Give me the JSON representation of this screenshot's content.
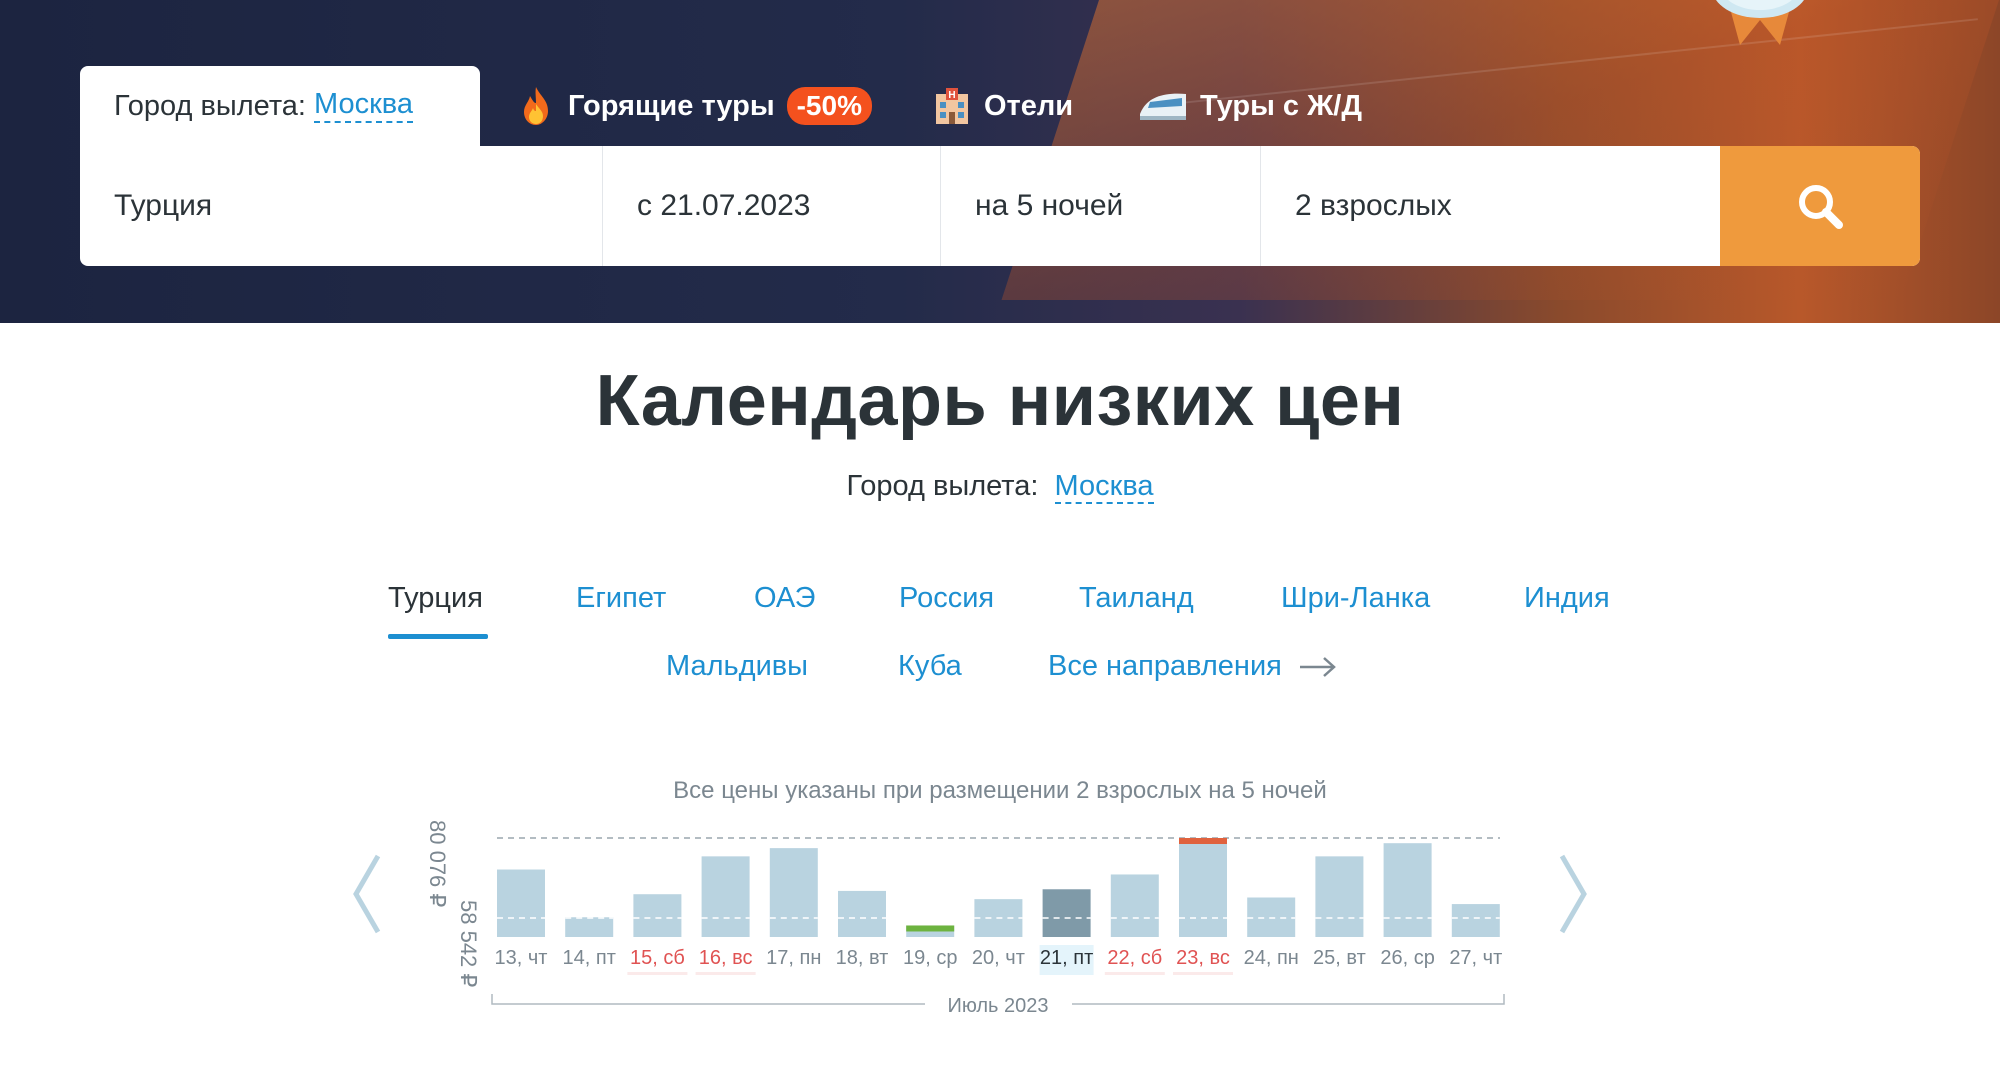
{
  "header": {
    "departure_label": "Город вылета:",
    "departure_city": "Москва",
    "tabs": [
      {
        "label": "Горящие туры",
        "badge": "-50%",
        "icon": "fire-icon"
      },
      {
        "label": "Отели",
        "icon": "hotel-icon"
      },
      {
        "label": "Туры с Ж/Д",
        "icon": "train-icon"
      }
    ]
  },
  "search": {
    "destination": "Турция",
    "date": "с 21.07.2023",
    "nights": "на 5 ночей",
    "guests": "2 взрослых",
    "button_icon": "search-icon"
  },
  "page": {
    "title": "Календарь низких цен",
    "departure_label": "Город вылета:",
    "departure_city": "Москва"
  },
  "countries": {
    "row1": [
      "Турция",
      "Египет",
      "ОАЭ",
      "Россия",
      "Таиланд",
      "Шри-Ланка",
      "Индия"
    ],
    "row2": [
      "Мальдивы",
      "Куба"
    ],
    "all_label": "Все направления",
    "active": "Турция"
  },
  "chart_note": "Все цены указаны при размещении 2 взрослых на 5 ночей",
  "chart_data": {
    "type": "bar",
    "categories": [
      "13, чт",
      "14, пт",
      "15, сб",
      "16, вс",
      "17, пн",
      "18, вт",
      "19, ср",
      "20, чт",
      "21, пт",
      "22, сб",
      "23, вс",
      "24, пн",
      "25, вт",
      "26, ср",
      "27, чт"
    ],
    "values": [
      70500,
      56000,
      63000,
      74500,
      77000,
      64000,
      53500,
      61500,
      64500,
      69000,
      80076,
      62000,
      74500,
      78500,
      60000
    ],
    "weekend": [
      false,
      false,
      true,
      true,
      false,
      false,
      false,
      false,
      false,
      true,
      true,
      false,
      false,
      false,
      false
    ],
    "selected_index": 8,
    "min_index": 6,
    "max_index": 10,
    "max_label": "80 076 ₽",
    "min_label": "58 542 ₽",
    "month_label": "Июль 2023",
    "colors": {
      "bar": "#b9d3e0",
      "selected": "#7f9aa8",
      "min": "#6db33f",
      "max": "#e0623e",
      "weekend_text": "#e05353",
      "normal_text": "#7b8790"
    }
  }
}
